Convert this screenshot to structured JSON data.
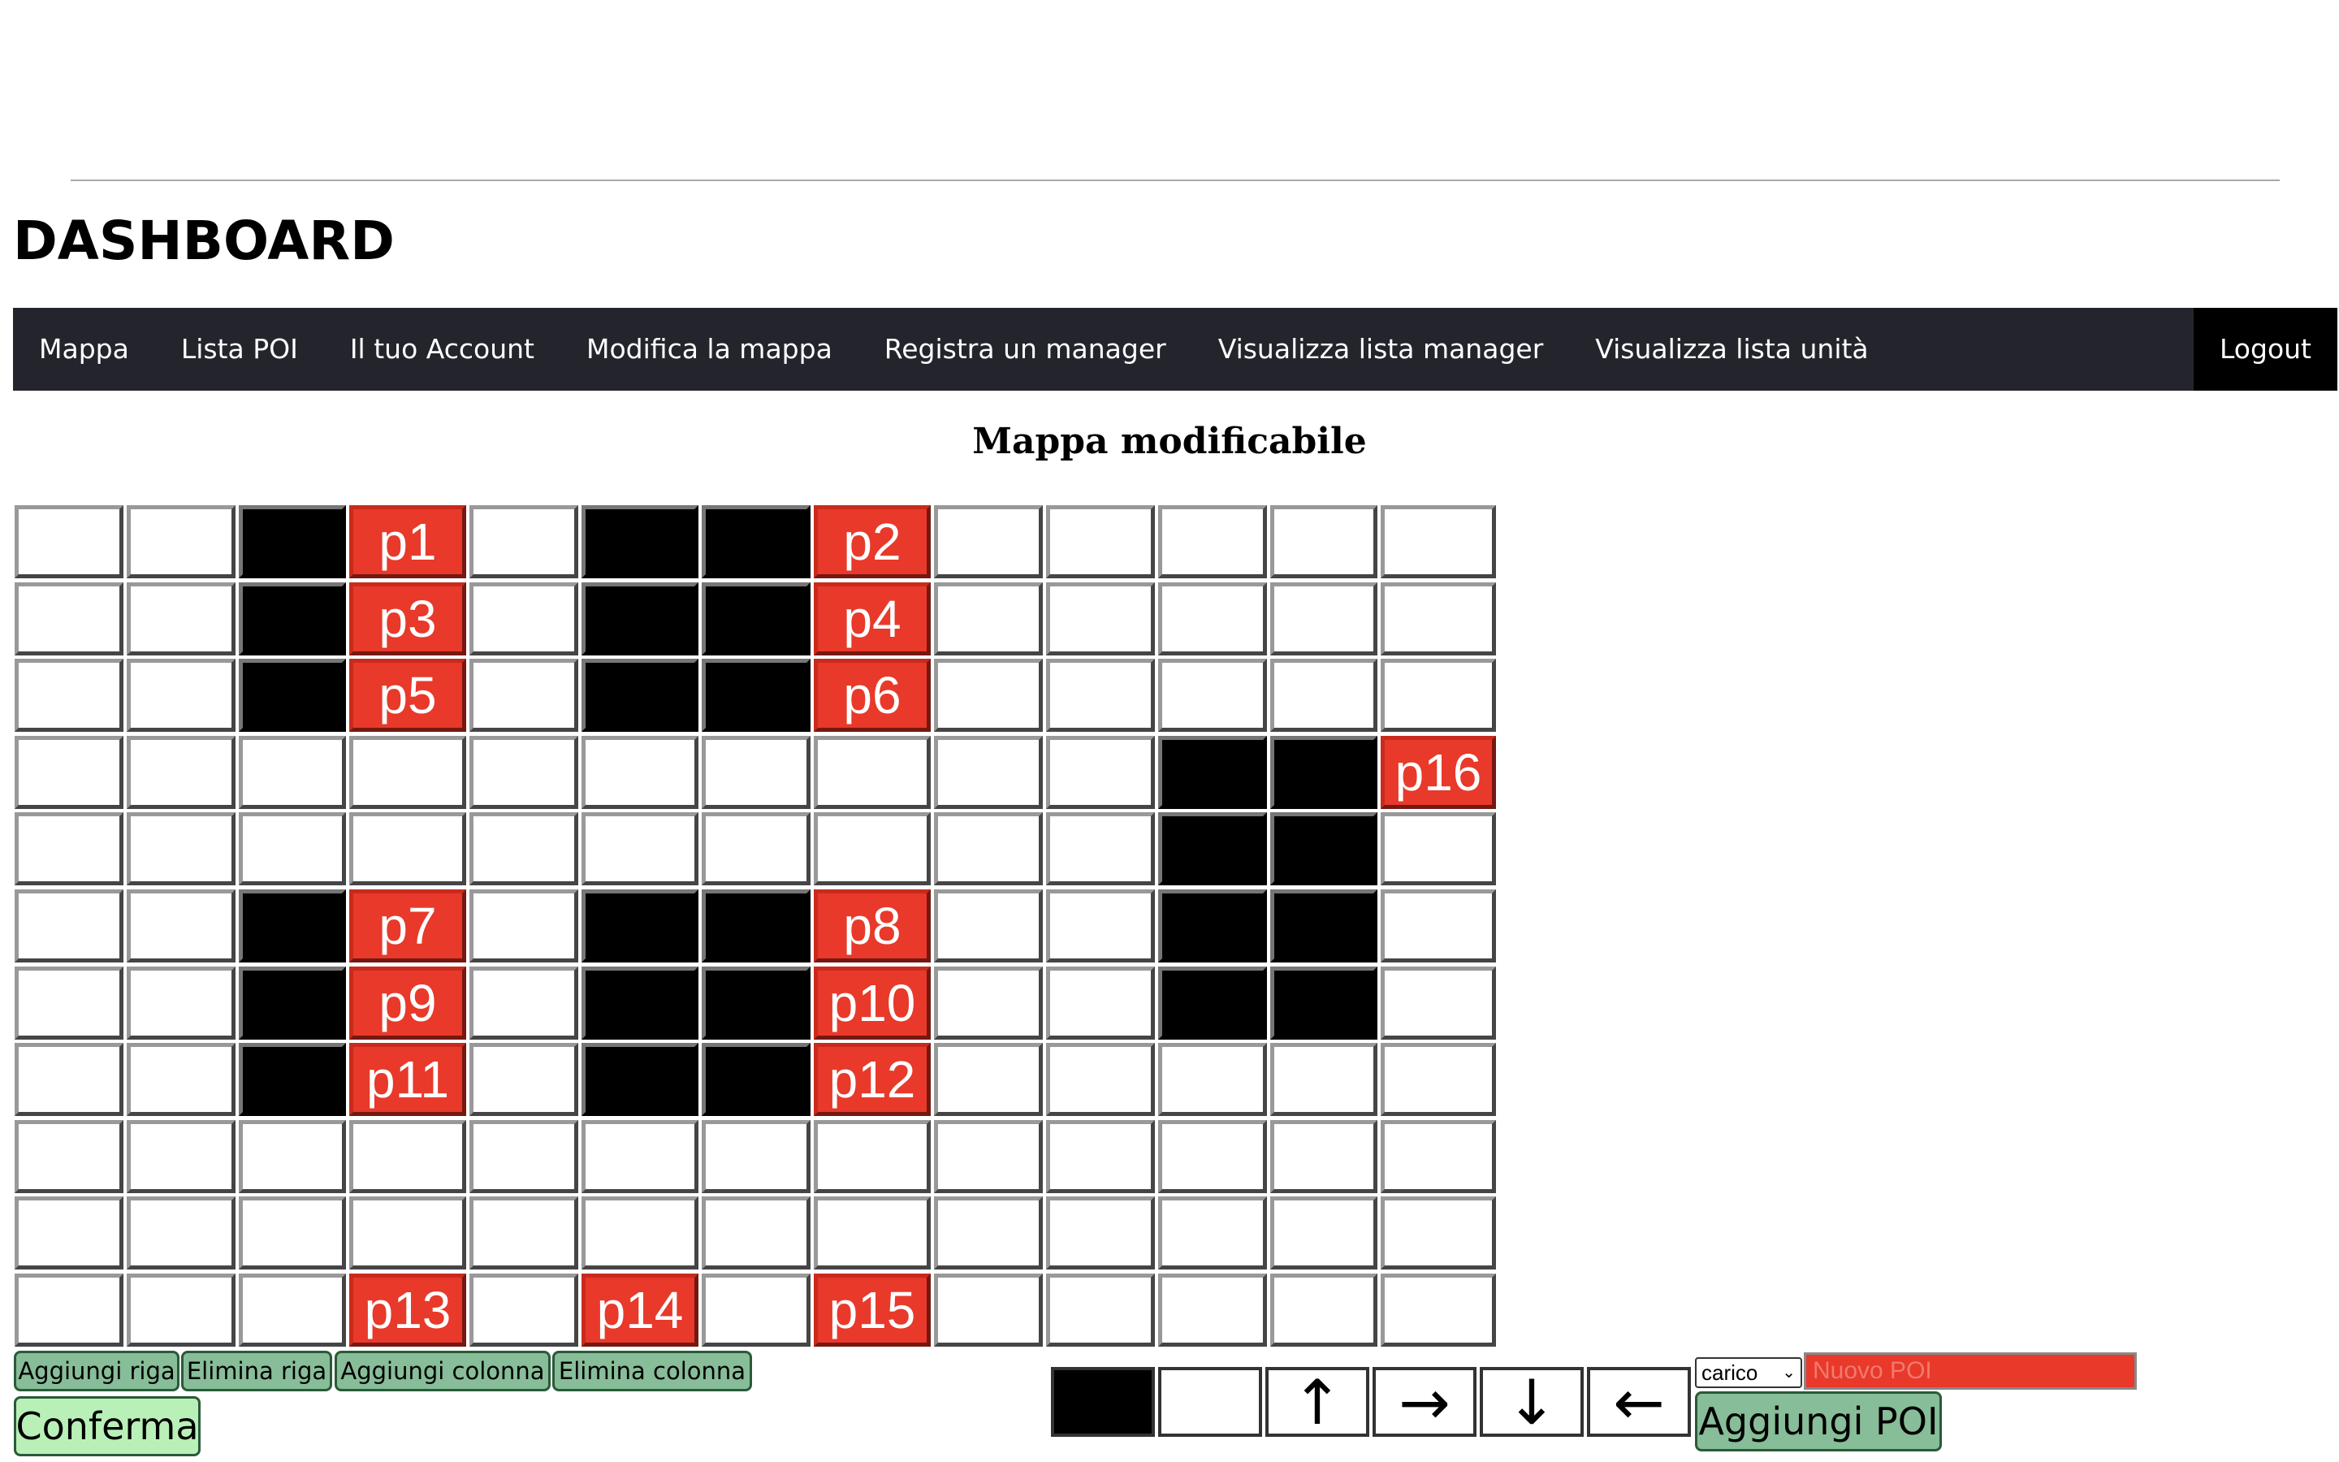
{
  "header": {
    "title": "DASHBOARD"
  },
  "nav": {
    "items": [
      "Mappa",
      "Lista POI",
      "Il tuo Account",
      "Modifica la mappa",
      "Registra un manager",
      "Visualizza lista manager",
      "Visualizza lista unità"
    ],
    "logout": "Logout"
  },
  "map": {
    "title": "Mappa modificabile",
    "rows": [
      [
        "",
        "",
        "#",
        "p1",
        "",
        "#",
        "#",
        "p2",
        "",
        "",
        "",
        "",
        ""
      ],
      [
        "",
        "",
        "#",
        "p3",
        "",
        "#",
        "#",
        "p4",
        "",
        "",
        "",
        "",
        ""
      ],
      [
        "",
        "",
        "#",
        "p5",
        "",
        "#",
        "#",
        "p6",
        "",
        "",
        "",
        "",
        ""
      ],
      [
        "",
        "",
        "",
        "",
        "",
        "",
        "",
        "",
        "",
        "",
        "#",
        "#",
        "p16"
      ],
      [
        "",
        "",
        "",
        "",
        "",
        "",
        "",
        "",
        "",
        "",
        "#",
        "#",
        ""
      ],
      [
        "",
        "",
        "#",
        "p7",
        "",
        "#",
        "#",
        "p8",
        "",
        "",
        "#",
        "#",
        ""
      ],
      [
        "",
        "",
        "#",
        "p9",
        "",
        "#",
        "#",
        "p10",
        "",
        "",
        "#",
        "#",
        ""
      ],
      [
        "",
        "",
        "#",
        "p11",
        "",
        "#",
        "#",
        "p12",
        "",
        "",
        "",
        "",
        ""
      ],
      [
        "",
        "",
        "",
        "",
        "",
        "",
        "",
        "",
        "",
        "",
        "",
        "",
        ""
      ],
      [
        "",
        "",
        "",
        "",
        "",
        "",
        "",
        "",
        "",
        "",
        "",
        "",
        ""
      ],
      [
        "",
        "",
        "",
        "p13",
        "",
        "p14",
        "",
        "p15",
        "",
        "",
        "",
        "",
        ""
      ]
    ]
  },
  "controls": {
    "add_row": "Aggiungi riga",
    "delete_row": "Elimina riga",
    "add_column": "Aggiungi colonna",
    "delete_column": "Elimina colonna",
    "confirm": "Conferma"
  },
  "tools": {
    "arrow_up": "↑",
    "arrow_right": "→",
    "arrow_down": "↓",
    "arrow_left": "←"
  },
  "poi_form": {
    "type_selected": "carico",
    "name_placeholder": "Nuovo POI",
    "add_button": "Aggiungi POI"
  }
}
